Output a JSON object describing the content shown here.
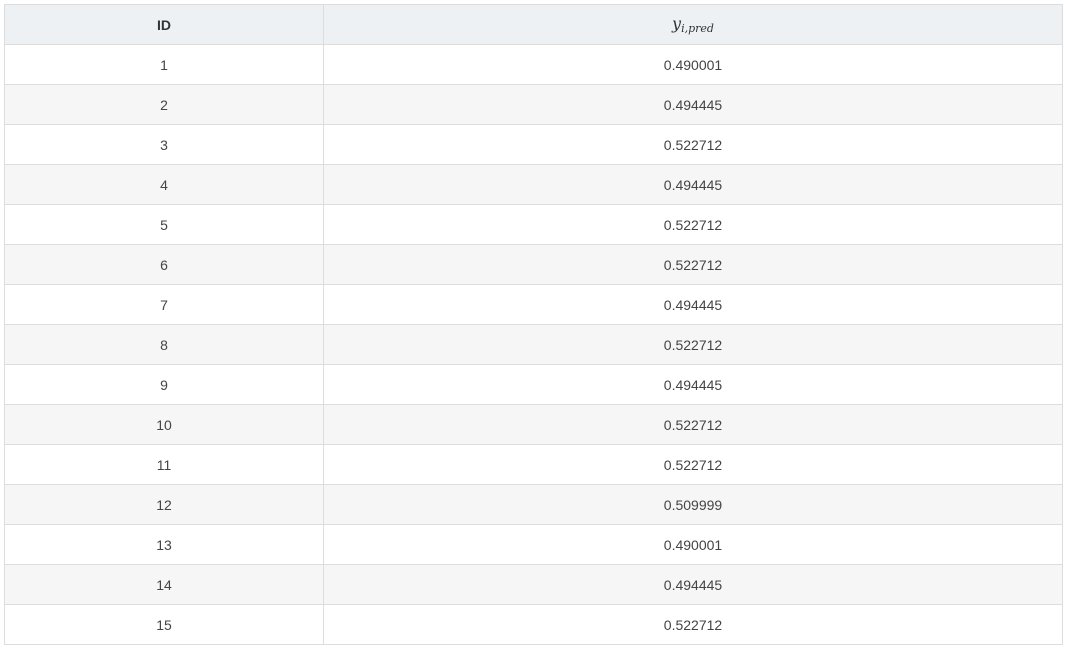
{
  "table": {
    "headers": {
      "id": "ID",
      "value_main": "y",
      "value_sub": "i,pred"
    },
    "rows": [
      {
        "id": "1",
        "value": "0.490001"
      },
      {
        "id": "2",
        "value": "0.494445"
      },
      {
        "id": "3",
        "value": "0.522712"
      },
      {
        "id": "4",
        "value": "0.494445"
      },
      {
        "id": "5",
        "value": "0.522712"
      },
      {
        "id": "6",
        "value": "0.522712"
      },
      {
        "id": "7",
        "value": "0.494445"
      },
      {
        "id": "8",
        "value": "0.522712"
      },
      {
        "id": "9",
        "value": "0.494445"
      },
      {
        "id": "10",
        "value": "0.522712"
      },
      {
        "id": "11",
        "value": "0.522712"
      },
      {
        "id": "12",
        "value": "0.509999"
      },
      {
        "id": "13",
        "value": "0.490001"
      },
      {
        "id": "14",
        "value": "0.494445"
      },
      {
        "id": "15",
        "value": "0.522712"
      }
    ]
  },
  "colors": {
    "header_bg": "#eef1f4",
    "stripe_bg": "#f6f6f6",
    "border": "#dddddd",
    "text": "#333333"
  }
}
